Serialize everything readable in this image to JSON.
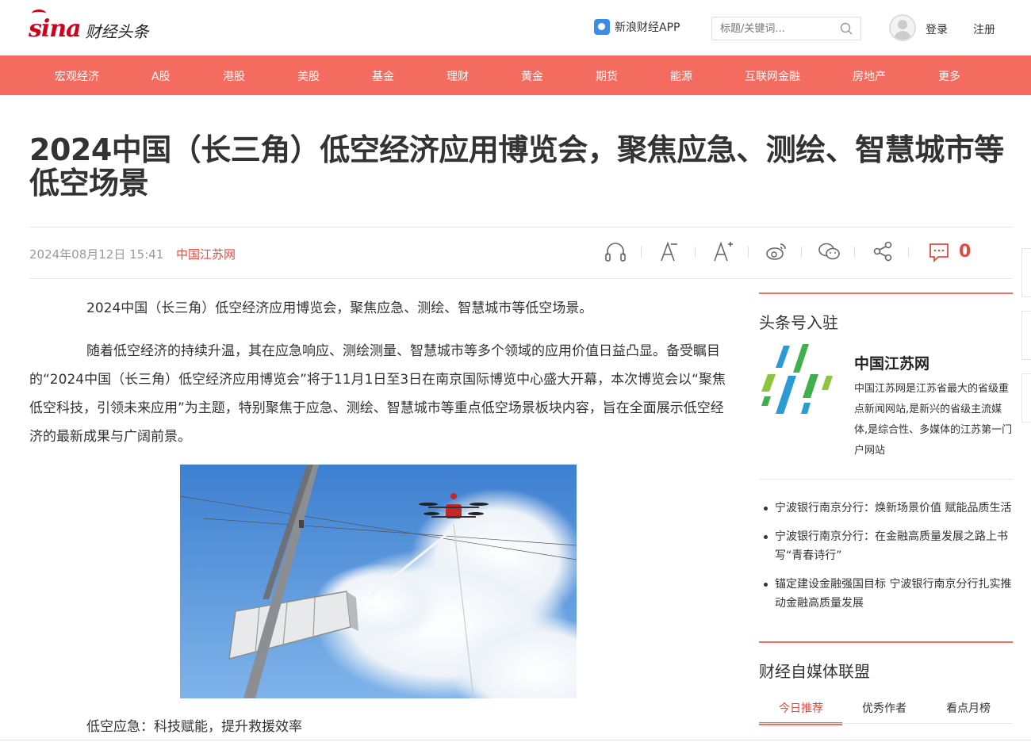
{
  "header": {
    "logo_sina": "sina",
    "logo_text": "财经头条",
    "app_link": "新浪财经APP",
    "search_placeholder": "标题/关键词...",
    "login": "登录",
    "register": "注册"
  },
  "nav": {
    "items": [
      "宏观经济",
      "A股",
      "港股",
      "美股",
      "基金",
      "理财",
      "黄金",
      "期货",
      "能源",
      "互联网金融",
      "房地产",
      "更多"
    ]
  },
  "article": {
    "title": "2024中国（长三角）低空经济应用博览会，聚焦应急、测绘、智慧城市等低空场景",
    "date": "2024年08月12日 15:41",
    "source": "中国江苏网",
    "comment_count": "0",
    "paragraphs": [
      "2024中国（长三角）低空经济应用博览会，聚焦应急、测绘、智慧城市等低空场景。",
      "随着低空经济的持续升温，其在应急响应、测绘测量、智慧城市等多个领域的应用价值日益凸显。备受瞩目的“2024中国（长三角）低空经济应用博览会”将于11月1日至3日在南京国际博览中心盛大开幕，本次博览会以“聚焦低空科技，引领未来应用”为主题，特别聚焦于应急、测绘、智慧城市等重点低空场景板块内容，旨在全面展示低空经济的最新成果与广阔前景。",
      "低空应急：科技赋能，提升救援效率"
    ]
  },
  "sidebar": {
    "section1_title": "头条号入驻",
    "media_name": "中国江苏网",
    "media_desc": "中国江苏网是江苏省最大的省级重点新闻网站,是新兴的省级主流媒体,是综合性、多媒体的江苏第一门户网站",
    "news": [
      "宁波银行南京分行：焕新场景价值 赋能品质生活",
      "宁波银行南京分行：在金融高质量发展之路上书写“青春诗行”",
      "锚定建设金融强国目标 宁波银行南京分行扎实推动金融高质量发展"
    ],
    "section2_title": "财经自媒体联盟",
    "tabs": [
      "今日推荐",
      "优秀作者",
      "看点月榜"
    ]
  },
  "colors": {
    "brand_red": "#d0021b",
    "nav_bg": "#f46b5f",
    "accent": "#e6493c"
  },
  "icons": [
    "headphones-icon",
    "font-decrease-icon",
    "font-increase-icon",
    "weibo-icon",
    "wechat-icon",
    "share-icon",
    "comment-icon",
    "search-icon"
  ]
}
